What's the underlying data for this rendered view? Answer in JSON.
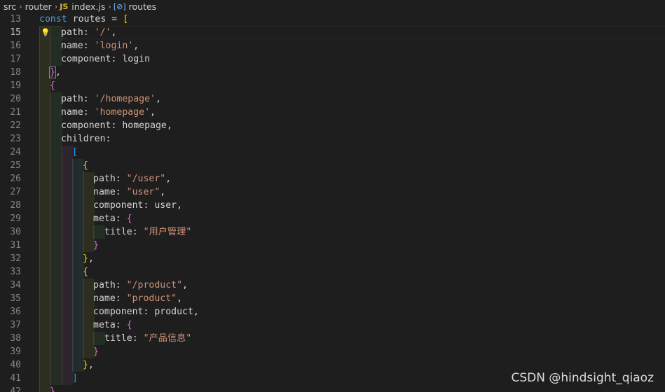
{
  "breadcrumb": {
    "items": [
      "src",
      "router",
      "index.js",
      "routes"
    ],
    "file_badge": "JS",
    "symbol_icon": "[⊘]"
  },
  "editor": {
    "active_line": 15,
    "lines": [
      {
        "n": "13",
        "text": "const routes = ["
      },
      {
        "n": "15",
        "text": "path: '/',"
      },
      {
        "n": "16",
        "text": "name: 'login',"
      },
      {
        "n": "17",
        "text": "component: login"
      },
      {
        "n": "18",
        "text": "},"
      },
      {
        "n": "19",
        "text": "{"
      },
      {
        "n": "20",
        "text": "path: '/homepage',"
      },
      {
        "n": "21",
        "text": "name: 'homepage',"
      },
      {
        "n": "22",
        "text": "component: homepage,"
      },
      {
        "n": "23",
        "text": "children:"
      },
      {
        "n": "24",
        "text": "["
      },
      {
        "n": "25",
        "text": "{"
      },
      {
        "n": "26",
        "text": "path: \"/user\","
      },
      {
        "n": "27",
        "text": "name: \"user\","
      },
      {
        "n": "28",
        "text": "component: user,"
      },
      {
        "n": "29",
        "text": "meta: {"
      },
      {
        "n": "30",
        "text": "title: \"用户管理\""
      },
      {
        "n": "31",
        "text": "}"
      },
      {
        "n": "32",
        "text": "},"
      },
      {
        "n": "33",
        "text": "{"
      },
      {
        "n": "34",
        "text": "path: \"/product\","
      },
      {
        "n": "35",
        "text": "name: \"product\","
      },
      {
        "n": "36",
        "text": "component: product,"
      },
      {
        "n": "37",
        "text": "meta: {"
      },
      {
        "n": "38",
        "text": "title: \"产品信息\""
      },
      {
        "n": "39",
        "text": "}"
      },
      {
        "n": "40",
        "text": "},"
      },
      {
        "n": "41",
        "text": "]"
      },
      {
        "n": "42",
        "text": "},"
      }
    ]
  },
  "watermark": "CSDN @hindsight_qiaoz",
  "colors": {
    "background": "#1e1e1e",
    "keyword": "#569cd6",
    "string": "#ce9178",
    "bracket_level1": "#ffd700",
    "bracket_level2": "#da70d6",
    "bracket_level3": "#179fff"
  }
}
